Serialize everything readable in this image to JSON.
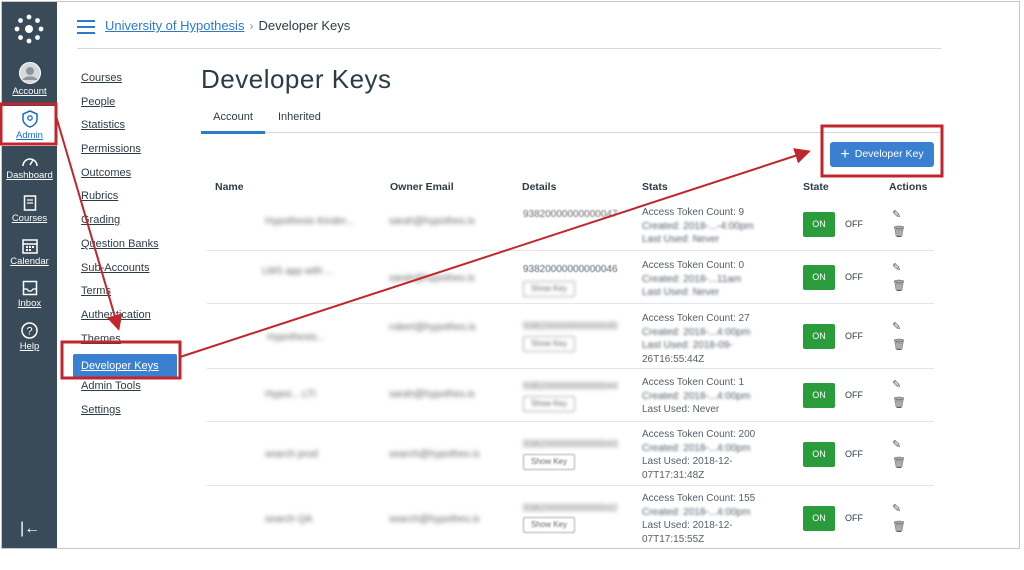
{
  "global_nav": {
    "items": [
      {
        "label": "Account",
        "icon": "account-avatar-icon"
      },
      {
        "label": "Admin",
        "icon": "shield-icon"
      },
      {
        "label": "Dashboard",
        "icon": "speedometer-icon"
      },
      {
        "label": "Courses",
        "icon": "book-icon"
      },
      {
        "label": "Calendar",
        "icon": "calendar-icon"
      },
      {
        "label": "Inbox",
        "icon": "inbox-icon"
      },
      {
        "label": "Help",
        "icon": "question-icon"
      }
    ],
    "collapse_glyph": "|←"
  },
  "breadcrumb": {
    "root": "University of Hypothesis",
    "sep": "›",
    "current": "Developer Keys"
  },
  "sub_nav": [
    "Courses",
    "People",
    "Statistics",
    "Permissions",
    "Outcomes",
    "Rubrics",
    "Grading",
    "Question Banks",
    "Sub-Accounts",
    "Terms",
    "Authentication",
    "Themes",
    "Developer Keys",
    "Admin Tools",
    "Settings"
  ],
  "page": {
    "title": "Developer Keys",
    "tabs": {
      "account": "Account",
      "inherited": "Inherited"
    },
    "add_button": "Developer Key",
    "headers": {
      "name": "Name",
      "email": "Owner Email",
      "details": "Details",
      "stats": "Stats",
      "state": "State",
      "actions": "Actions"
    }
  },
  "rows": [
    {
      "name": "Hypothesis Kinder...",
      "email": "sarah@hypothes.is",
      "details": "93820000000000047",
      "show_key": "",
      "stats": [
        "Access Token Count: 9",
        "Created: 2018-...-4:00pm",
        "Last Used: Never"
      ],
      "on": "ON",
      "off": "OFF"
    },
    {
      "name": "LMS app with ...",
      "email": "sarah@hypothes.is",
      "details": "93820000000000046",
      "show_key": "Show Key",
      "stats": [
        "Access Token Count: 0",
        "Created: 2018-...11am",
        "Last Used: Never"
      ],
      "on": "ON",
      "off": "OFF"
    },
    {
      "name": "Hypothesis...",
      "email": "robert@hypothes.is",
      "details": "93820000000000045",
      "show_key": "Show Key",
      "stats": [
        "Access Token Count: 27",
        "Created: 2018-...4:00pm",
        "Last Used: 2018-09-",
        "26T16:55:44Z"
      ],
      "on": "ON",
      "off": "OFF"
    },
    {
      "name": "Hypot... LTI",
      "email": "sarah@hypothes.is",
      "details": "93820000000000044",
      "show_key": "Show Key",
      "stats": [
        "Access Token Count: 1",
        "Created: 2018-...4:00pm",
        "Last Used: Never"
      ],
      "on": "ON",
      "off": "OFF"
    },
    {
      "name": "search prod",
      "email": "search@hypothes.is",
      "details": "93820000000000043",
      "show_key": "Show Key",
      "stats": [
        "Access Token Count: 200",
        "Created: 2018-...4:00pm",
        "Last Used: 2018-12-",
        "07T17:31:48Z"
      ],
      "on": "ON",
      "off": "OFF"
    },
    {
      "name": "search QA",
      "email": "search@hypothes.is",
      "details": "93820000000000042",
      "show_key": "Show Key",
      "stats": [
        "Access Token Count: 155",
        "Created: 2018-...4:00pm",
        "Last Used: 2018-12-",
        "07T17:15:55Z"
      ],
      "on": "ON",
      "off": "OFF"
    }
  ],
  "colors": {
    "nav_bg": "#394b58",
    "accent": "#3a7fd0",
    "toggle_on": "#2a9c3b",
    "annotation": "#c0262d"
  }
}
